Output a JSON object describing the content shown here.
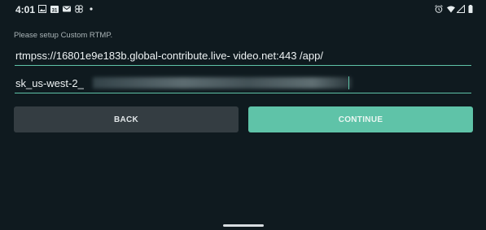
{
  "status_bar": {
    "time": "4:01",
    "left_icons": [
      "image-icon",
      "calendar-icon",
      "gmail-icon",
      "pinwheel-icon",
      "dot-icon"
    ],
    "calendar_day": "31",
    "right_icons": [
      "alarm-icon",
      "wifi-icon",
      "signal-icon",
      "battery-icon"
    ]
  },
  "form": {
    "prompt": "Please setup Custom RTMP.",
    "url_value": "rtmpss://16801e9e183b.global-contribute.live- video.net:443 /app/",
    "key_value_visible": "sk_us-west-2_"
  },
  "buttons": {
    "back_label": "BACK",
    "continue_label": "CONTINUE"
  },
  "colors": {
    "background": "#0f1a1f",
    "accent": "#5fc3a8",
    "back_button": "#343d42"
  }
}
